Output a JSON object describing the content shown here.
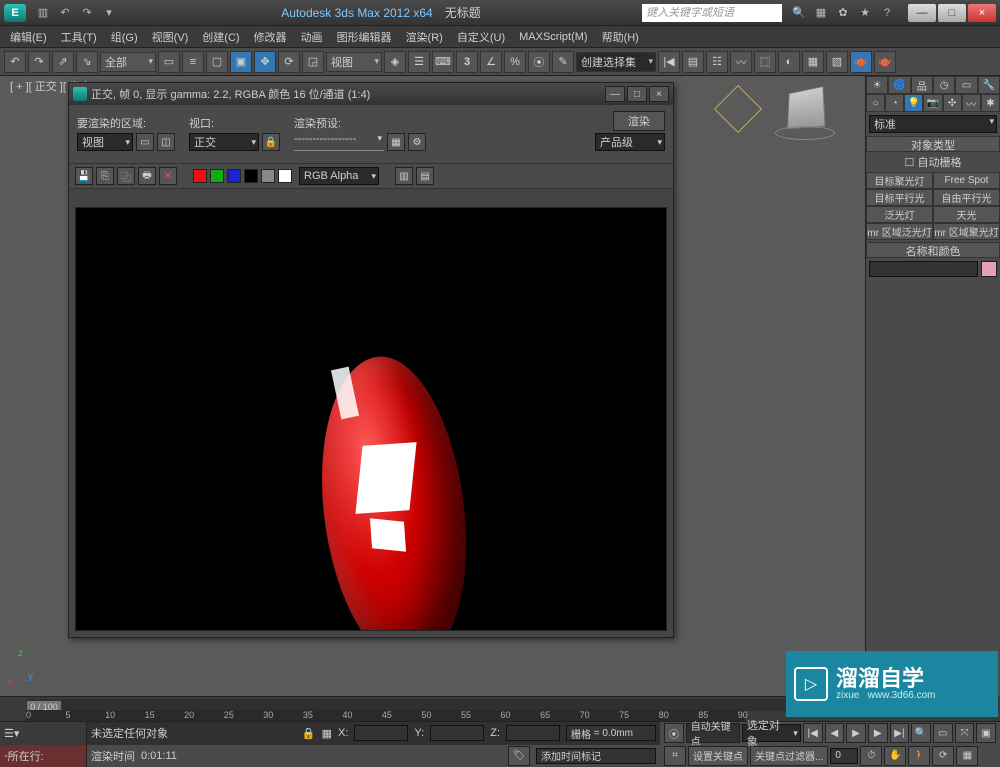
{
  "title": {
    "app": "Autodesk 3ds Max  2012 x64",
    "doc": "无标题",
    "search_placeholder": "键入关键字或短语"
  },
  "win_btns": {
    "min": "—",
    "max": "□",
    "close": "×"
  },
  "menus": [
    "编辑(E)",
    "工具(T)",
    "组(G)",
    "视图(V)",
    "创建(C)",
    "修改器",
    "动画",
    "图形编辑器",
    "渲染(R)",
    "自定义(U)",
    "MAXScript(M)",
    "帮助(H)"
  ],
  "maintoolbar": {
    "all_dd": "全部",
    "view_dd": "视图",
    "selset_dd": "创建选择集"
  },
  "viewport_label": "[ + ][ 正交 ][ 真实 ]",
  "axis": {
    "x": "x",
    "y": "y",
    "z": "z"
  },
  "render_window": {
    "title": "正交, 帧 0, 显示 gamma: 2.2, RGBA 颜色 16 位/通道 (1:4)",
    "render_btn": "渲染",
    "area_label": "要渲染的区域:",
    "area_value": "视图",
    "viewport_label": "视口:",
    "viewport_value": "正交",
    "preset_label": "渲染预设:",
    "preset_value": "-----------------",
    "output_value": "产品级",
    "channel_dd": "RGB Alpha"
  },
  "cmd_panel": {
    "std_dd": "标准",
    "rollout1": "对象类型",
    "autogrid": "自动栅格",
    "lights": [
      [
        "目标聚光灯",
        "Free Spot"
      ],
      [
        "目标平行光",
        "自由平行光"
      ],
      [
        "泛光灯",
        "天光"
      ],
      [
        "mr 区域泛光灯",
        "mr 区域聚光灯"
      ]
    ],
    "rollout2": "名称和颜色"
  },
  "timeline": {
    "slider": "0 / 100",
    "ticks": [
      "0",
      "5",
      "10",
      "15",
      "20",
      "25",
      "30",
      "35",
      "40",
      "45",
      "50",
      "55",
      "60",
      "65",
      "70",
      "75",
      "80",
      "85",
      "90"
    ]
  },
  "status": {
    "cur_row_label": "所在行:",
    "no_sel": "未选定任何对象",
    "render_time_label": "渲染时间",
    "render_time_val": "0:01:11",
    "add_time_tag": "添加时间标记",
    "x": "X:",
    "y": "Y:",
    "z": "Z:",
    "grid_label": "栅格",
    "grid_val": "= 0.0mm",
    "autokey": "自动关键点",
    "selset_dd": "选定对象",
    "setkey": "设置关键点",
    "keyfilter": "关键点过滤器..."
  },
  "logo": {
    "big": "溜溜自学",
    "sub": "zixue",
    "url": "www.3d66.com"
  }
}
